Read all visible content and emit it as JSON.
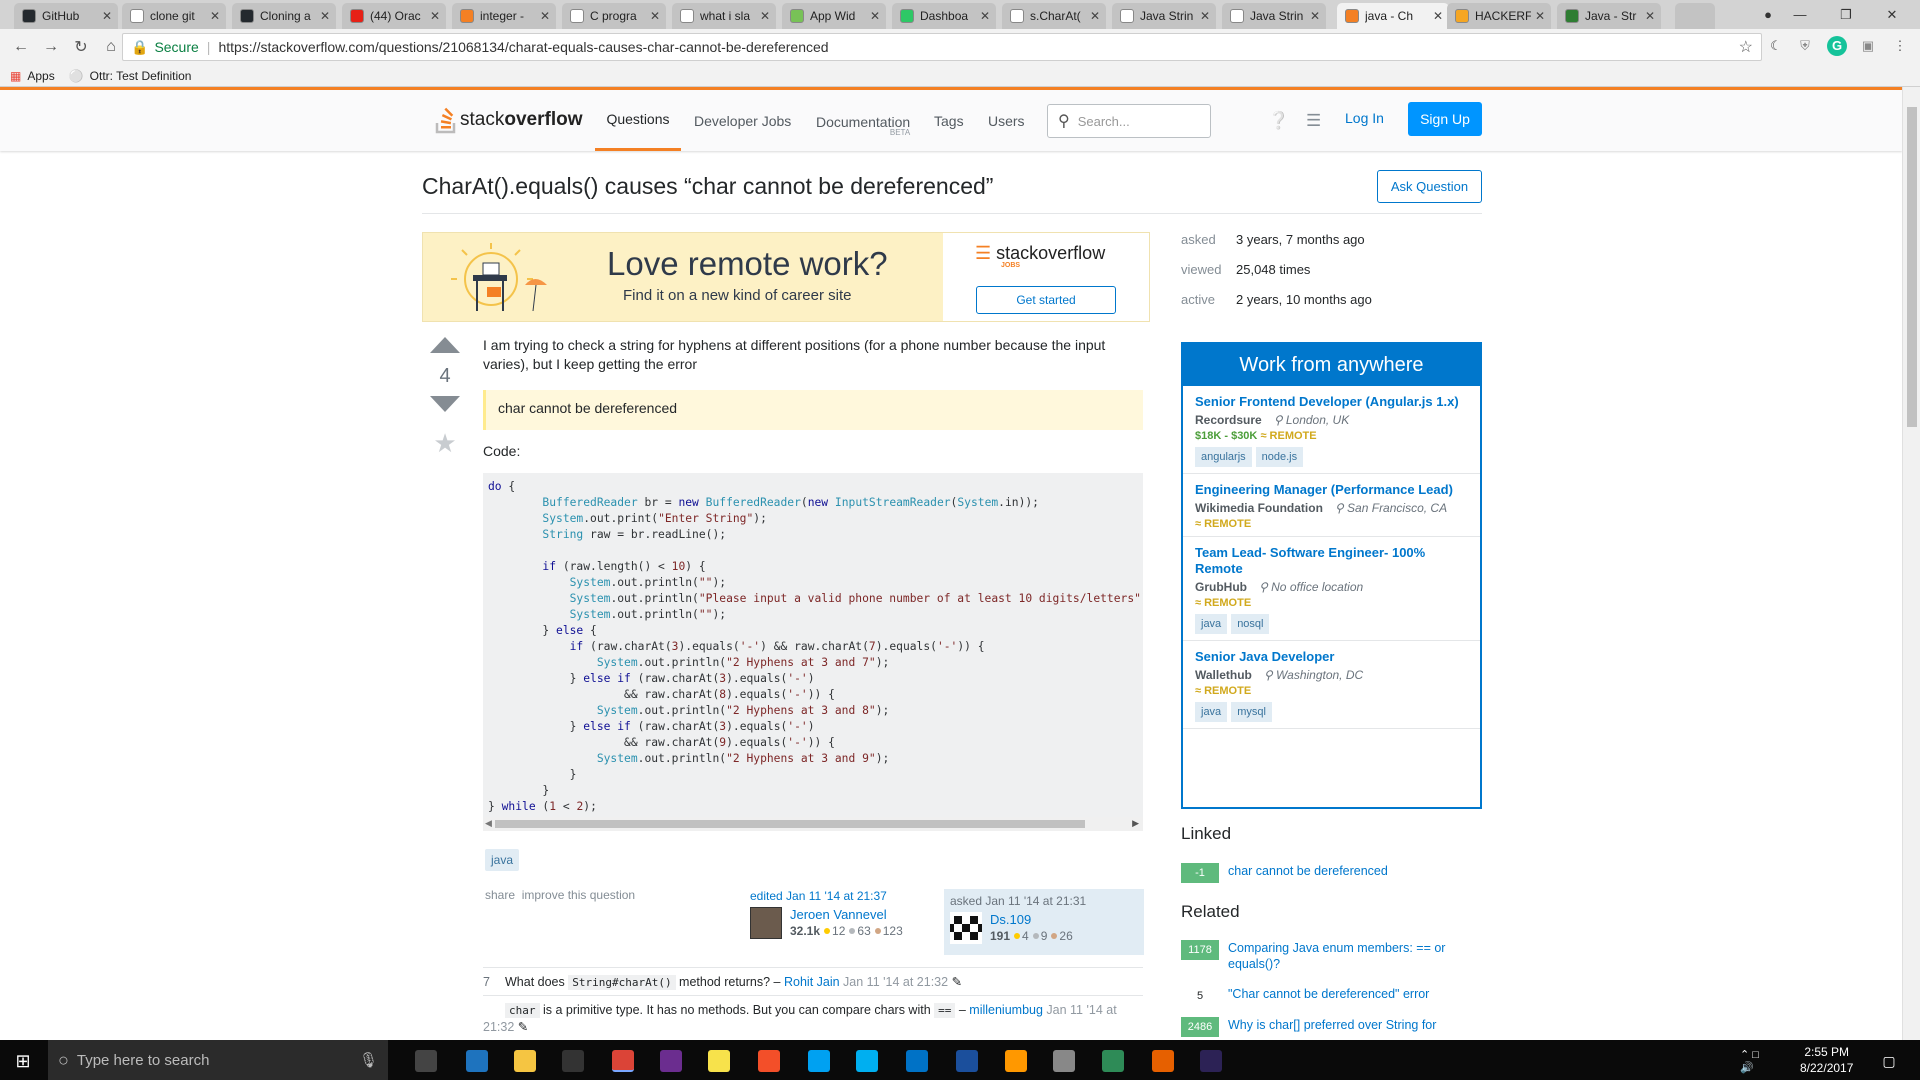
{
  "browser": {
    "tabs": [
      {
        "label": "GitHub",
        "color": "#24292e"
      },
      {
        "label": "clone git",
        "color": "#ffffff"
      },
      {
        "label": "Cloning a",
        "color": "#24292e"
      },
      {
        "label": "(44) Orac",
        "color": "#e62117"
      },
      {
        "label": "integer -",
        "color": "#f48024"
      },
      {
        "label": "C progra",
        "color": "#ffffff"
      },
      {
        "label": "what i sla",
        "color": "#ffffff"
      },
      {
        "label": "App Wid",
        "color": "#78c257"
      },
      {
        "label": "Dashboa",
        "color": "#2ec866"
      },
      {
        "label": "s.CharAt(",
        "color": "#ffffff"
      },
      {
        "label": "Java Strin",
        "color": "#ffffff"
      },
      {
        "label": "Java Strin",
        "color": "#ffffff"
      },
      {
        "label": "java - Ch",
        "color": "#f48024"
      },
      {
        "label": "HACKERF",
        "color": "#f5a623"
      },
      {
        "label": "Java - Str",
        "color": "#2e7d32"
      }
    ],
    "secure_label": "Secure",
    "url": "https://stackoverflow.com/questions/21068134/charat-equals-causes-char-cannot-be-dereferenced",
    "bookmarks": [
      {
        "label": "Apps"
      },
      {
        "label": "Ottr: Test Definition"
      }
    ]
  },
  "so": {
    "logo_prefix": "stack",
    "logo_bold": "overflow",
    "nav": [
      "Questions",
      "Developer Jobs",
      "Documentation",
      "Tags",
      "Users"
    ],
    "doc_beta": "BETA",
    "search_placeholder": "Search...",
    "login": "Log In",
    "signup": "Sign Up",
    "title": "CharAt().equals() causes “char cannot be dereferenced”",
    "ask_question": "Ask Question",
    "ad": {
      "headline": "Love remote work?",
      "sub": "Find it on a new kind of career site",
      "brand": "stackoverflow",
      "brand_sub": "JOBS",
      "cta": "Get started"
    },
    "meta": {
      "asked_k": "asked",
      "asked_v": "3 years, 7 months ago",
      "viewed_k": "viewed",
      "viewed_v": "25,048 times",
      "active_k": "active",
      "active_v": "2 years, 10 months ago"
    },
    "votes": "4",
    "body": "I am trying to check a string for hyphens at different positions (for a phone number because the input varies), but I keep getting the error",
    "quote": "char cannot be dereferenced",
    "code_label": "Code:",
    "tag": "java",
    "share": "share",
    "improve": "improve this question",
    "edited": {
      "when": "edited Jan 11 '14 at 21:37",
      "user": "Jeroen Vannevel",
      "rep": "32.1k",
      "gold": "12",
      "silver": "63",
      "bronze": "123"
    },
    "asked": {
      "when": "asked Jan 11 '14 at 21:31",
      "user": "Ds.109",
      "rep": "191",
      "gold": "4",
      "silver": "9",
      "bronze": "26"
    },
    "comments": [
      {
        "score": "7",
        "pre": "What does ",
        "code": "String#charAt()",
        "post": " method returns? – ",
        "author": "Rohit Jain",
        "date": " Jan 11 '14 at 21:32"
      },
      {
        "score": "",
        "pre": "",
        "code": "char",
        "post": " is a primitive type. It has no methods. But you can compare chars with ",
        "code2": "==",
        "post2": " – ",
        "author": "milleniumbug",
        "date": " Jan 11 '14 at 21:32"
      }
    ],
    "jobs": {
      "header": "Work from anywhere",
      "items": [
        {
          "title": "Senior Frontend Developer (Angular.js 1.x)",
          "company": "Recordsure",
          "location": "London, UK",
          "salary": "$18K - $30K",
          "remote": "REMOTE",
          "tags": [
            "angularjs",
            "node.js"
          ]
        },
        {
          "title": "Engineering Manager (Performance Lead)",
          "company": "Wikimedia Foundation",
          "location": "San Francisco, CA",
          "salary": "",
          "remote": "REMOTE",
          "tags": []
        },
        {
          "title": "Team Lead- Software Engineer- 100% Remote",
          "company": "GrubHub",
          "location": "No office location",
          "salary": "",
          "remote": "REMOTE",
          "tags": [
            "java",
            "nosql"
          ]
        },
        {
          "title": "Senior Java Developer",
          "company": "Wallethub",
          "location": "Washington, DC",
          "salary": "",
          "remote": "REMOTE",
          "tags": [
            "java",
            "mysql"
          ]
        }
      ]
    },
    "linked_heading": "Linked",
    "linked": [
      {
        "count": "-1",
        "text": "char cannot be dereferenced"
      }
    ],
    "related_heading": "Related",
    "related": [
      {
        "count": "1178",
        "text": "Comparing Java enum members: == or equals()?"
      },
      {
        "count": "5",
        "text": "\"Char cannot be dereferenced\" error"
      },
      {
        "count": "2486",
        "text": "Why is char[] preferred over String for"
      }
    ]
  },
  "taskbar": {
    "search_placeholder": "Type here to search",
    "time": "2:55 PM",
    "date": "8/22/2017"
  }
}
